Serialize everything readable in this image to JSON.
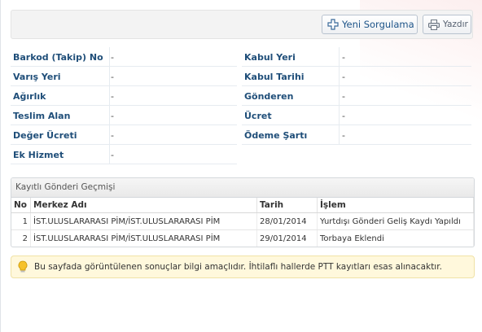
{
  "toolbar": {
    "new_query_label": "Yeni Sorgulama",
    "new_query_icon": "plus-icon",
    "print_label": "Yazdır",
    "print_icon": "printer-icon"
  },
  "details": {
    "left": [
      {
        "label": "Barkod (Takip) No",
        "value": "-"
      },
      {
        "label": "Varış Yeri",
        "value": "-"
      },
      {
        "label": "Ağırlık",
        "value": "-"
      },
      {
        "label": "Teslim Alan",
        "value": "-"
      },
      {
        "label": "Değer Ücreti",
        "value": "-"
      },
      {
        "label": "Ek Hizmet",
        "value": "-"
      }
    ],
    "right": [
      {
        "label": "Kabul Yeri",
        "value": "-"
      },
      {
        "label": "Kabul Tarihi",
        "value": "-"
      },
      {
        "label": "Gönderen",
        "value": "-"
      },
      {
        "label": "Ücret",
        "value": "-"
      },
      {
        "label": "Ödeme Şartı",
        "value": "-"
      }
    ]
  },
  "history": {
    "title": "Kayıtlı Gönderi Geçmişi",
    "columns": [
      "No",
      "Merkez Adı",
      "Tarih",
      "İşlem"
    ],
    "rows": [
      [
        "1",
        "İST.ULUSLARARASI PİM/İST.ULUSLARARASI PİM",
        "28/01/2014",
        "Yurtdışı Gönderi Geliş Kaydı Yapıldı"
      ],
      [
        "2",
        "İST.ULUSLARARASI PİM/İST.ULUSLARARASI PİM",
        "29/01/2014",
        "Torbaya Eklendi"
      ]
    ]
  },
  "notice": {
    "icon": "lightbulb-icon",
    "text": "Bu sayfada görüntülenen sonuçlar bilgi amaçlıdır. İhtilaflı hallerde PTT kayıtları esas alınacaktır."
  },
  "colors": {
    "label": "#1f4e79",
    "button_text": "#1c5388",
    "notice_bg": "#fff8dc"
  }
}
